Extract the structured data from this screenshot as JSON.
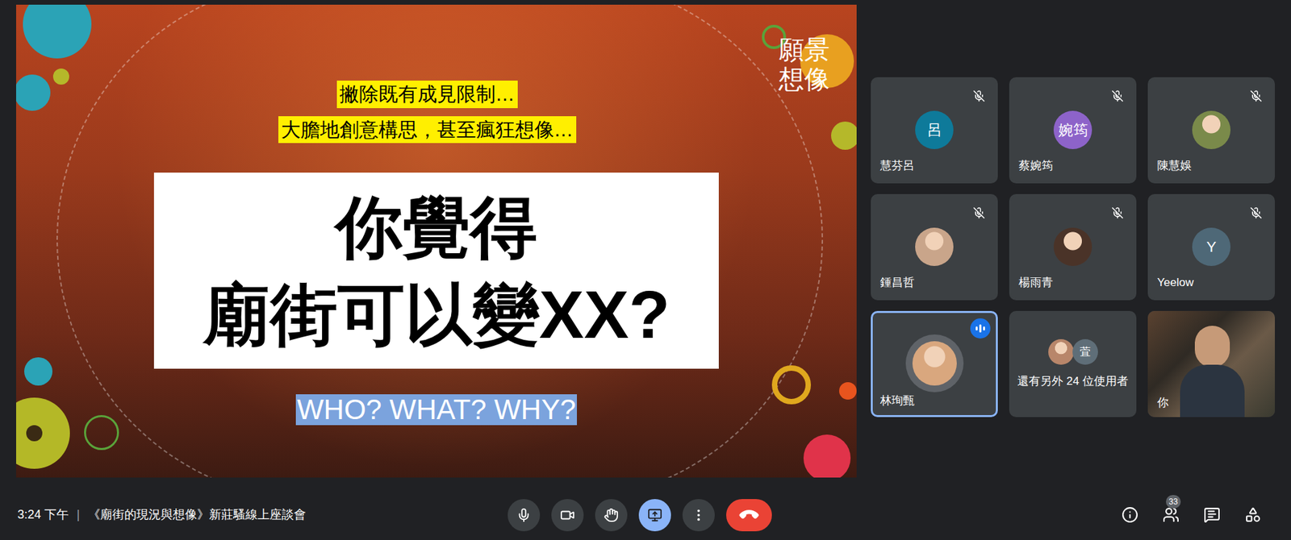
{
  "meeting": {
    "time": "3:24 下午",
    "separator": "|",
    "title": "《廟街的現況與想像》新莊騷線上座談會"
  },
  "slide": {
    "corner_label_lines": [
      "願景",
      "想像"
    ],
    "prompts": [
      "撇除既有成見限制…",
      "大膽地創意構思，甚至瘋狂想像…"
    ],
    "headline_lines": [
      "你覺得",
      "廟街可以變XX?"
    ],
    "subtitle": "WHO? WHAT? WHY?",
    "subtitle_selected": true
  },
  "participants": [
    {
      "name": "慧芬呂",
      "avatar": {
        "kind": "initial",
        "text": "呂",
        "color": "#0e7a9a"
      },
      "muted": true,
      "speaking": false
    },
    {
      "name": "蔡婉筠",
      "avatar": {
        "kind": "initial",
        "text": "婉筠",
        "color": "#8d63c9"
      },
      "muted": true,
      "speaking": false
    },
    {
      "name": "陳慧娛",
      "avatar": {
        "kind": "photo",
        "text": "",
        "color": "#7a8a4a"
      },
      "muted": true,
      "speaking": false
    },
    {
      "name": "鍾昌哲",
      "avatar": {
        "kind": "photo",
        "text": "",
        "color": "#c9a58a"
      },
      "muted": true,
      "speaking": false
    },
    {
      "name": "楊雨青",
      "avatar": {
        "kind": "photo",
        "text": "",
        "color": "#4a3328"
      },
      "muted": true,
      "speaking": false
    },
    {
      "name": "Yeelow",
      "avatar": {
        "kind": "initial",
        "text": "Y",
        "color": "#4e6877"
      },
      "muted": true,
      "speaking": false
    },
    {
      "name": "林珣甄",
      "avatar": {
        "kind": "photo",
        "text": "",
        "color": "#d9a77e"
      },
      "muted": false,
      "speaking": true
    }
  ],
  "others": {
    "label": "還有另外 24 位使用者",
    "avatars": [
      {
        "kind": "photo",
        "text": "",
        "color": "#b8866a"
      },
      {
        "kind": "initial",
        "text": "萓",
        "color": "#5f6e78"
      }
    ]
  },
  "self": {
    "name": "你",
    "video": true
  },
  "controls": [
    {
      "kind": "mic",
      "active": false
    },
    {
      "kind": "camera",
      "active": false
    },
    {
      "kind": "hand",
      "active": false
    },
    {
      "kind": "present",
      "active": true
    },
    {
      "kind": "more",
      "active": false
    },
    {
      "kind": "hangup",
      "active": false
    }
  ],
  "side_controls": [
    {
      "kind": "info",
      "badge": ""
    },
    {
      "kind": "people",
      "badge": "33"
    },
    {
      "kind": "chat",
      "badge": ""
    },
    {
      "kind": "activities",
      "badge": ""
    }
  ]
}
